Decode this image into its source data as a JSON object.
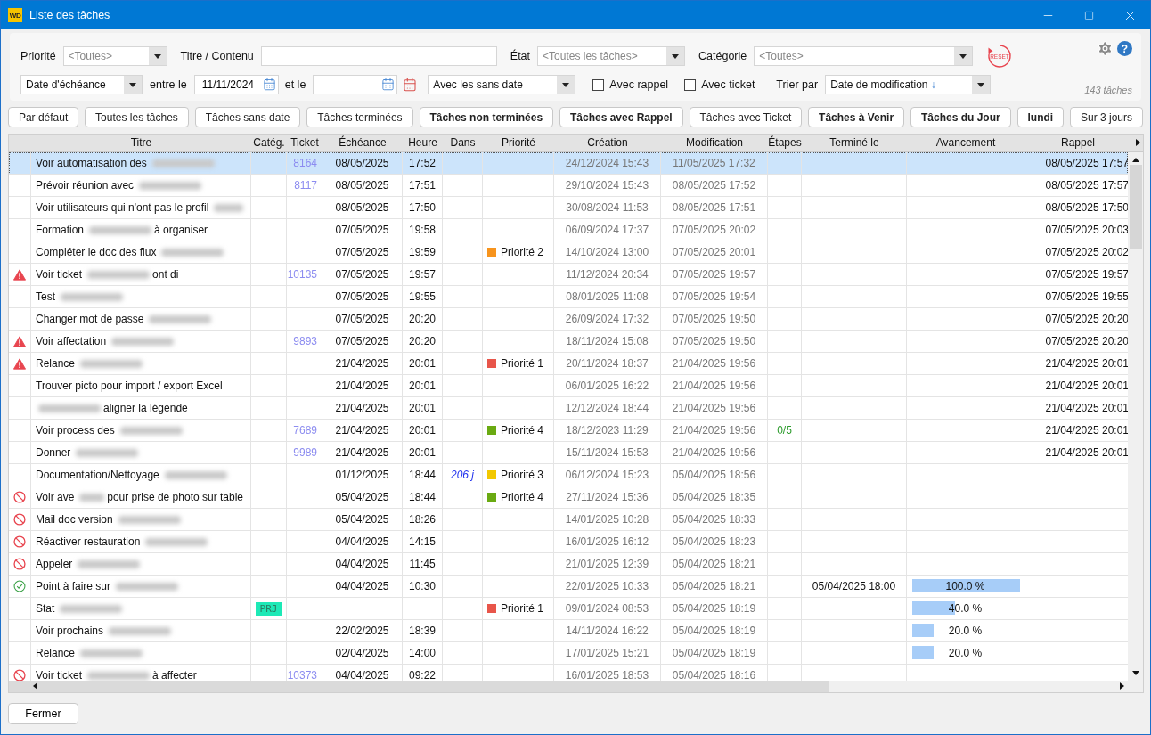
{
  "window": {
    "logo": "WD",
    "title": "Liste des tâches"
  },
  "filters": {
    "priority": {
      "label": "Priorité",
      "value": "<Toutes>"
    },
    "title_search": {
      "label": "Titre / Contenu"
    },
    "state": {
      "label": "État",
      "value": "<Toutes les tâches>"
    },
    "category": {
      "label": "Catégorie",
      "value": "<Toutes>"
    },
    "reset_label": "RESET",
    "help": "?",
    "date_field": {
      "value": "Date d'échéance"
    },
    "between_label": "entre le",
    "date_from": "11/11/2024",
    "and_label": "et le",
    "undated": {
      "value": "Avec les sans date"
    },
    "checkboxes": [
      {
        "label": "Avec rappel",
        "checked": false
      },
      {
        "label": "Avec ticket",
        "checked": false
      }
    ],
    "sort": {
      "label": "Trier par",
      "value": "Date de modification",
      "arrow": "↓"
    },
    "count": "143 tâches"
  },
  "quick_buttons": [
    {
      "label": "Par défaut",
      "bold": false
    },
    {
      "label": "Toutes les tâches",
      "bold": false
    },
    {
      "label": "Tâches sans date",
      "bold": false
    },
    {
      "label": "Tâches terminées",
      "bold": false
    },
    {
      "label": "Tâches non terminées",
      "bold": true
    },
    {
      "label": "Tâches avec Rappel",
      "bold": true
    },
    {
      "label": "Tâches avec Ticket",
      "bold": false
    },
    {
      "label": "Tâches à Venir",
      "bold": true
    },
    {
      "label": "Tâches du Jour",
      "bold": true
    },
    {
      "label": "lundi",
      "bold": true
    },
    {
      "label": "Sur 3 jours",
      "bold": false
    }
  ],
  "table": {
    "columns": [
      "Titre",
      "Catég.",
      "Ticket",
      "Échéance",
      "Heure",
      "Dans",
      "Priorité",
      "Création",
      "Modification",
      "Étapes",
      "Terminé le",
      "Avancement",
      "Rappel"
    ],
    "rows": [
      {
        "selected": true,
        "title": [
          {
            "kind": "text",
            "text": "Voir automatisation des"
          },
          {
            "kind": "redacted"
          }
        ],
        "ticket": "8164",
        "due_date": "08/05/2025",
        "due_time": "17:52",
        "created": "24/12/2024 15:43",
        "modified": "11/05/2025 17:32",
        "reminder": "08/05/2025 17:57"
      },
      {
        "selected": false,
        "title": [
          {
            "kind": "text",
            "text": "Prévoir réunion avec"
          },
          {
            "kind": "redacted"
          }
        ],
        "ticket": "8117",
        "due_date": "08/05/2025",
        "due_time": "17:51",
        "created": "29/10/2024 15:43",
        "modified": "08/05/2025 17:52",
        "reminder": "08/05/2025 17:57"
      },
      {
        "selected": false,
        "title": [
          {
            "kind": "text",
            "text": "Voir utilisateurs qui n'ont pas le profil"
          },
          {
            "kind": "redacted"
          }
        ],
        "due_date": "08/05/2025",
        "due_time": "17:50",
        "created": "30/08/2024 11:53",
        "modified": "08/05/2025 17:51",
        "reminder": "08/05/2025 17:50"
      },
      {
        "selected": false,
        "title": [
          {
            "kind": "text",
            "text": "Formation"
          },
          {
            "kind": "redacted"
          },
          {
            "kind": "text",
            "text": "à organiser"
          }
        ],
        "due_date": "07/05/2025",
        "due_time": "19:58",
        "created": "06/09/2024 17:37",
        "modified": "07/05/2025 20:02",
        "reminder": "07/05/2025 20:03"
      },
      {
        "selected": false,
        "title": [
          {
            "kind": "text",
            "text": "Compléter le doc des flux"
          },
          {
            "kind": "redacted"
          }
        ],
        "due_date": "07/05/2025",
        "due_time": "19:59",
        "priority": {
          "label": "Priorité 2",
          "color": "#f7941d"
        },
        "created": "14/10/2024 13:00",
        "modified": "07/05/2025 20:01",
        "reminder": "07/05/2025 20:02"
      },
      {
        "selected": false,
        "status": {
          "kind": "warning"
        },
        "title": [
          {
            "kind": "text",
            "text": "Voir ticket"
          },
          {
            "kind": "redacted"
          },
          {
            "kind": "text",
            "text": "ont di"
          }
        ],
        "ticket": "10135",
        "due_date": "07/05/2025",
        "due_time": "19:57",
        "created": "11/12/2024 20:34",
        "modified": "07/05/2025 19:57",
        "reminder": "07/05/2025 19:57"
      },
      {
        "selected": false,
        "title": [
          {
            "kind": "text",
            "text": "Test"
          },
          {
            "kind": "redacted"
          }
        ],
        "due_date": "07/05/2025",
        "due_time": "19:55",
        "created": "08/01/2025 11:08",
        "modified": "07/05/2025 19:54",
        "reminder": "07/05/2025 19:55"
      },
      {
        "selected": false,
        "title": [
          {
            "kind": "text",
            "text": "Changer mot de passe"
          },
          {
            "kind": "redacted"
          }
        ],
        "due_date": "07/05/2025",
        "due_time": "20:20",
        "created": "26/09/2024 17:32",
        "modified": "07/05/2025 19:50",
        "reminder": "07/05/2025 20:20"
      },
      {
        "selected": false,
        "status": {
          "kind": "warning"
        },
        "title": [
          {
            "kind": "text",
            "text": "Voir affectation"
          },
          {
            "kind": "redacted"
          }
        ],
        "ticket": "9893",
        "due_date": "07/05/2025",
        "due_time": "20:20",
        "created": "18/11/2024 15:08",
        "modified": "07/05/2025 19:50",
        "reminder": "07/05/2025 20:20"
      },
      {
        "selected": false,
        "status": {
          "kind": "warning"
        },
        "title": [
          {
            "kind": "text",
            "text": "Relance"
          },
          {
            "kind": "redacted"
          }
        ],
        "due_date": "21/04/2025",
        "due_time": "20:01",
        "priority": {
          "label": "Priorité 1",
          "color": "#e8554a"
        },
        "created": "20/11/2024 18:37",
        "modified": "21/04/2025 19:56",
        "reminder": "21/04/2025 20:01"
      },
      {
        "selected": false,
        "title": [
          {
            "kind": "text",
            "text": "Trouver picto pour import / export Excel"
          }
        ],
        "due_date": "21/04/2025",
        "due_time": "20:01",
        "created": "06/01/2025 16:22",
        "modified": "21/04/2025 19:56",
        "reminder": "21/04/2025 20:01"
      },
      {
        "selected": false,
        "title": [
          {
            "kind": "redacted"
          },
          {
            "kind": "text",
            "text": "aligner la légende"
          }
        ],
        "due_date": "21/04/2025",
        "due_time": "20:01",
        "created": "12/12/2024 18:44",
        "modified": "21/04/2025 19:56",
        "reminder": "21/04/2025 20:01"
      },
      {
        "selected": false,
        "title": [
          {
            "kind": "text",
            "text": "Voir process des"
          },
          {
            "kind": "redacted"
          }
        ],
        "ticket": "7689",
        "due_date": "21/04/2025",
        "due_time": "20:01",
        "priority": {
          "label": "Priorité 4",
          "color": "#6aaa12"
        },
        "created": "18/12/2023 11:29",
        "modified": "21/04/2025 19:56",
        "steps": "0/5",
        "reminder": "21/04/2025 20:01"
      },
      {
        "selected": false,
        "title": [
          {
            "kind": "text",
            "text": "Donner"
          },
          {
            "kind": "redacted"
          }
        ],
        "ticket": "9989",
        "due_date": "21/04/2025",
        "due_time": "20:01",
        "created": "15/11/2024 15:53",
        "modified": "21/04/2025 19:56",
        "reminder": "21/04/2025 20:01"
      },
      {
        "selected": false,
        "title": [
          {
            "kind": "text",
            "text": "Documentation/Nettoyage"
          },
          {
            "kind": "redacted"
          }
        ],
        "due_date": "01/12/2025",
        "due_time": "18:44",
        "in_days": "206 j",
        "priority": {
          "label": "Priorité 3",
          "color": "#f2c800"
        },
        "created": "06/12/2024 15:23",
        "modified": "05/04/2025 18:56"
      },
      {
        "selected": false,
        "status": {
          "kind": "blocked"
        },
        "title": [
          {
            "kind": "text",
            "text": "Voir ave"
          },
          {
            "kind": "redacted"
          },
          {
            "kind": "text",
            "text": "pour prise de photo sur table"
          }
        ],
        "due_date": "05/04/2025",
        "due_time": "18:44",
        "priority": {
          "label": "Priorité 4",
          "color": "#6aaa12"
        },
        "created": "27/11/2024 15:36",
        "modified": "05/04/2025 18:35"
      },
      {
        "selected": false,
        "status": {
          "kind": "blocked"
        },
        "title": [
          {
            "kind": "text",
            "text": "Mail doc version"
          },
          {
            "kind": "redacted"
          }
        ],
        "due_date": "05/04/2025",
        "due_time": "18:26",
        "created": "14/01/2025 10:28",
        "modified": "05/04/2025 18:33"
      },
      {
        "selected": false,
        "status": {
          "kind": "blocked"
        },
        "title": [
          {
            "kind": "text",
            "text": "Réactiver restauration"
          },
          {
            "kind": "redacted"
          }
        ],
        "due_date": "04/04/2025",
        "due_time": "14:15",
        "created": "16/01/2025 16:12",
        "modified": "05/04/2025 18:23"
      },
      {
        "selected": false,
        "status": {
          "kind": "blocked"
        },
        "title": [
          {
            "kind": "text",
            "text": "Appeler"
          },
          {
            "kind": "redacted"
          }
        ],
        "due_date": "04/04/2025",
        "due_time": "11:45",
        "created": "21/01/2025 12:39",
        "modified": "05/04/2025 18:21"
      },
      {
        "selected": false,
        "status": {
          "kind": "done"
        },
        "title": [
          {
            "kind": "text",
            "text": "Point à faire sur"
          },
          {
            "kind": "redacted"
          }
        ],
        "due_date": "04/04/2025",
        "due_time": "10:30",
        "created": "22/01/2025 10:33",
        "modified": "05/04/2025 18:21",
        "done_on": "05/04/2025 18:00",
        "progress": {
          "level": 1,
          "label": "100.0 %"
        }
      },
      {
        "selected": false,
        "title": [
          {
            "kind": "text",
            "text": "Stat"
          },
          {
            "kind": "redacted"
          }
        ],
        "category": {
          "label": "PRJ",
          "color": "#1de9b6"
        },
        "priority": {
          "label": "Priorité 1",
          "color": "#e8554a"
        },
        "created": "09/01/2024 08:53",
        "modified": "05/04/2025 18:19",
        "progress": {
          "level": 0.4,
          "label": "40.0 %"
        }
      },
      {
        "selected": false,
        "title": [
          {
            "kind": "text",
            "text": "Voir prochains"
          },
          {
            "kind": "redacted"
          }
        ],
        "due_date": "22/02/2025",
        "due_time": "18:39",
        "created": "14/11/2024 16:22",
        "modified": "05/04/2025 18:19",
        "progress": {
          "level": 0.2,
          "label": "20.0 %"
        }
      },
      {
        "selected": false,
        "title": [
          {
            "kind": "text",
            "text": "Relance"
          },
          {
            "kind": "redacted"
          }
        ],
        "due_date": "02/04/2025",
        "due_time": "14:00",
        "created": "17/01/2025 15:21",
        "modified": "05/04/2025 18:19",
        "progress": {
          "level": 0.2,
          "label": "20.0 %"
        }
      },
      {
        "selected": false,
        "status": {
          "kind": "blocked"
        },
        "title": [
          {
            "kind": "text",
            "text": "Voir ticket"
          },
          {
            "kind": "redacted"
          },
          {
            "kind": "text",
            "text": "à affecter"
          }
        ],
        "ticket": "10373",
        "due_date": "04/04/2025",
        "due_time": "09:22",
        "created": "16/01/2025 18:53",
        "modified": "05/04/2025 18:16"
      }
    ]
  },
  "close_button": "Fermer"
}
